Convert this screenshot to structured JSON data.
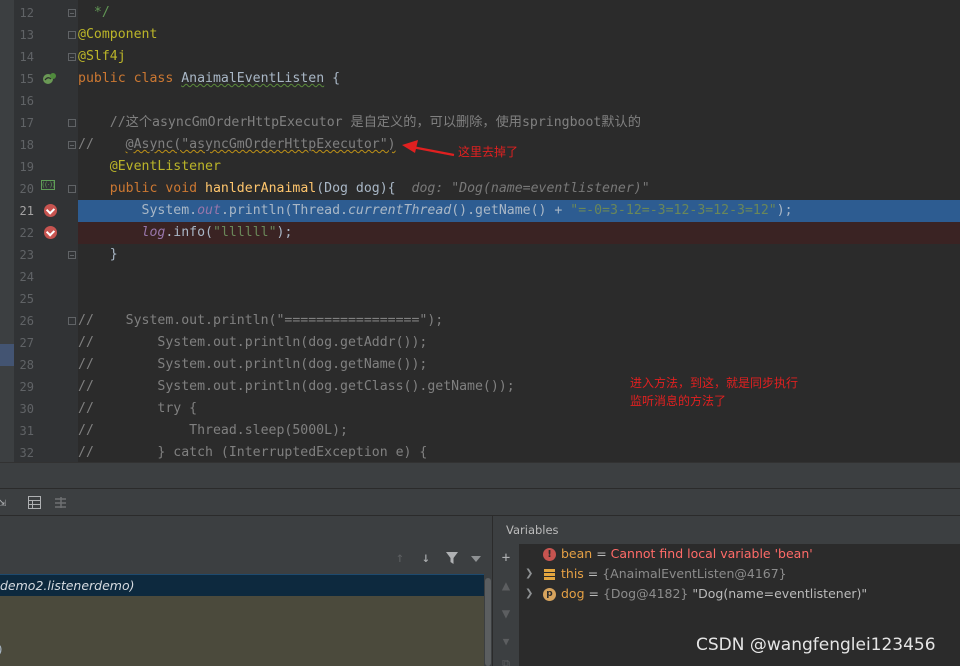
{
  "editor": {
    "line_numbers": [
      "12",
      "13",
      "14",
      "15",
      "16",
      "17",
      "18",
      "19",
      "20",
      "21",
      "22",
      "23",
      "24",
      "25",
      "26",
      "27",
      "28",
      "29",
      "30",
      "31",
      "32"
    ],
    "lines": {
      "l12": "*/",
      "l13": "@Component",
      "l14": "@Slf4j",
      "l15_kw": "public class ",
      "l15_cls": "AnaimalEventListen",
      "l15_end": " {",
      "l17": "//这个asyncGmOrderHttpExecutor 是自定义的，可以删除，使用springboot默认的",
      "l18_a": "//    ",
      "l18_b": "@Async(\"asyncGmOrderHttpExecutor\")",
      "l19": "@EventListener",
      "l20_kw": "public void ",
      "l20_fn": "hanlderAnaimal",
      "l20_params": "(Dog dog){",
      "l20_hint": "dog: \"Dog(name=eventlistener)\"",
      "l21_a": "System.",
      "l21_out": "out",
      "l21_b": ".println(Thread.",
      "l21_ct": "currentThread",
      "l21_c": "().getName() + ",
      "l21_str": "\"=-0=3-12=-3=12-3=12-3=12\"",
      "l21_d": ");",
      "l22_log": "log",
      "l22_a": ".info(",
      "l22_str": "\"llllll\"",
      "l22_b": ");",
      "l23": "}",
      "l26": "//    System.out.println(\"=================\");",
      "l27": "//        System.out.println(dog.getAddr());",
      "l28": "//        System.out.println(dog.getName());",
      "l29": "//        System.out.println(dog.getClass().getName());",
      "l30": "//        try {",
      "l31": "//            Thread.sleep(5000L);",
      "l32": "//        } catch (InterruptedException e) {"
    },
    "annotation_removed": "这里去掉了",
    "annotation_sync_1": "进入方法，到这，就是同步执行",
    "annotation_sync_2": "监听消息的方法了"
  },
  "debugger": {
    "thread_row": "demo2.listenerdemo)",
    "frames_partial": ")",
    "variables_title": "Variables",
    "variables": [
      {
        "name": "bean",
        "sep": " = ",
        "value": "Cannot find local variable 'bean'",
        "kind": "error",
        "icon": "error-icon"
      },
      {
        "name": "this",
        "sep": " = ",
        "ref": "{AnaimalEventListen@4167}",
        "value": "",
        "kind": "field",
        "icon": "field-icon"
      },
      {
        "name": "dog",
        "sep": " = ",
        "ref": "{Dog@4182}",
        "value": " \"Dog(name=eventlistener)\"",
        "kind": "param",
        "icon": "parameter-icon"
      }
    ],
    "param_icon_letter": "p",
    "error_icon_letter": "!"
  },
  "watermark": "CSDN @wangfenglei123456",
  "colors": {
    "editor_bg": "#2b2b2b",
    "execution_line": "#2d5c91",
    "breakpoint": "#c75450",
    "annotation_red": "#e02020"
  }
}
